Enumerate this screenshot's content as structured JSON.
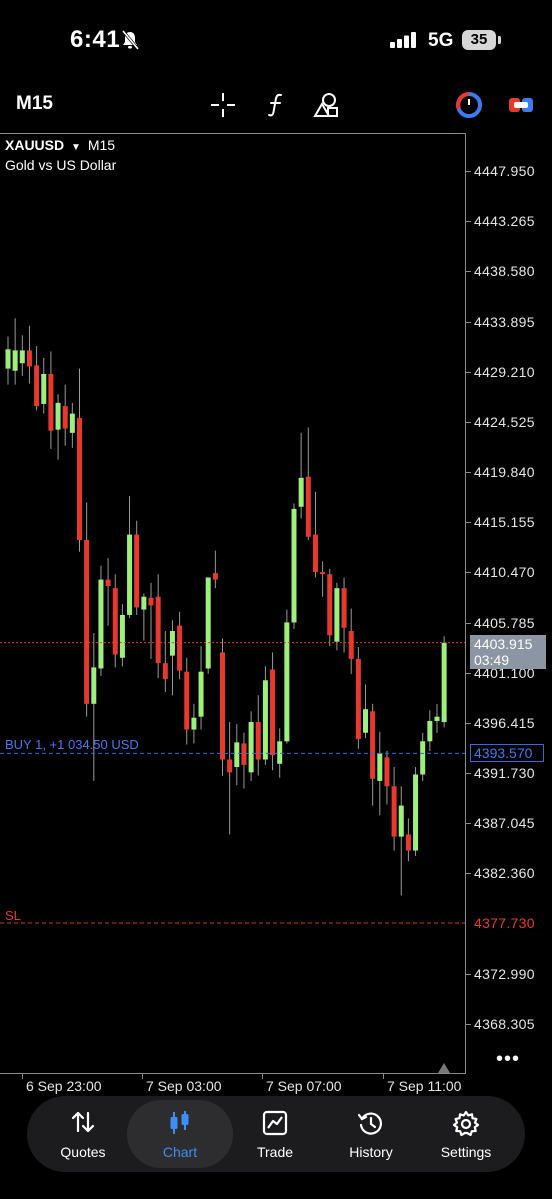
{
  "status_bar": {
    "time": "6:41",
    "network": "5G",
    "battery": "35"
  },
  "toolbar": {
    "timeframe": "M15",
    "icons": [
      "crosshair-icon",
      "indicator-icon",
      "objects-icon",
      "clock-icon",
      "trade-toggle-icon"
    ]
  },
  "chart": {
    "symbol": "XAUUSD",
    "timeframe": "M15",
    "description": "Gold vs US Dollar",
    "colors": {
      "bull": "#9ef07c",
      "bear": "#e8392f",
      "bid_line": "#e0402d",
      "buy_line": "#3c67d8",
      "sl_line": "#d8342d",
      "axis": "#8a8a8a"
    },
    "price_axis": [
      "4447.950",
      "4443.265",
      "4438.580",
      "4433.895",
      "4429.210",
      "4424.525",
      "4419.840",
      "4415.155",
      "4410.470",
      "4405.785",
      "4401.100",
      "4396.415",
      "4391.730",
      "4387.045",
      "4382.360",
      "4377.730",
      "4372.990",
      "4368.305"
    ],
    "bid_price": "4403.915",
    "bar_countdown": "03:49",
    "buy_label": "BUY 1, +1 034.50 USD",
    "buy_price": "4393.570",
    "sl_label": "SL",
    "sl_price": "4377.730",
    "time_axis": [
      "6 Sep 23:00",
      "7 Sep 03:00",
      "7 Sep 07:00",
      "7 Sep 11:00"
    ]
  },
  "chart_data": {
    "type": "candlestick",
    "symbol": "XAUUSD",
    "timeframe": "M15",
    "ylim": [
      4365.5,
      4451.3
    ],
    "candles": [
      {
        "o": 4429.5,
        "h": 4432.5,
        "l": 4428.0,
        "c": 4431.3
      },
      {
        "o": 4429.3,
        "h": 4434.2,
        "l": 4428.0,
        "c": 4431.2
      },
      {
        "o": 4430.0,
        "h": 4432.6,
        "l": 4428.8,
        "c": 4431.2
      },
      {
        "o": 4431.2,
        "h": 4433.5,
        "l": 4428.1,
        "c": 4429.7
      },
      {
        "o": 4429.8,
        "h": 4431.6,
        "l": 4425.6,
        "c": 4426.0
      },
      {
        "o": 4426.2,
        "h": 4430.5,
        "l": 4425.3,
        "c": 4429.0
      },
      {
        "o": 4429.0,
        "h": 4431.1,
        "l": 4422.0,
        "c": 4423.7
      },
      {
        "o": 4423.8,
        "h": 4427.1,
        "l": 4421.0,
        "c": 4426.3
      },
      {
        "o": 4426.0,
        "h": 4428.0,
        "l": 4422.3,
        "c": 4423.9
      },
      {
        "o": 4423.5,
        "h": 4426.3,
        "l": 4422.1,
        "c": 4425.3
      },
      {
        "o": 4424.9,
        "h": 4429.5,
        "l": 4412.4,
        "c": 4413.5
      },
      {
        "o": 4413.5,
        "h": 4417.0,
        "l": 4397.0,
        "c": 4398.2
      },
      {
        "o": 4398.2,
        "h": 4404.8,
        "l": 4391.0,
        "c": 4401.6
      },
      {
        "o": 4401.5,
        "h": 4411.1,
        "l": 4400.8,
        "c": 4409.8
      },
      {
        "o": 4409.8,
        "h": 4411.8,
        "l": 4405.5,
        "c": 4409.2
      },
      {
        "o": 4409.0,
        "h": 4410.3,
        "l": 4401.6,
        "c": 4402.8
      },
      {
        "o": 4402.5,
        "h": 4407.5,
        "l": 4401.7,
        "c": 4406.5
      },
      {
        "o": 4406.5,
        "h": 4417.6,
        "l": 4406.2,
        "c": 4414.0
      },
      {
        "o": 4414.0,
        "h": 4415.3,
        "l": 4406.5,
        "c": 4407.2
      },
      {
        "o": 4407.0,
        "h": 4408.5,
        "l": 4404.1,
        "c": 4408.2
      },
      {
        "o": 4408.1,
        "h": 4409.5,
        "l": 4402.4,
        "c": 4407.4
      },
      {
        "o": 4408.2,
        "h": 4410.3,
        "l": 4400.6,
        "c": 4402.0
      },
      {
        "o": 4402.0,
        "h": 4405.0,
        "l": 4399.3,
        "c": 4400.5
      },
      {
        "o": 4402.7,
        "h": 4406.0,
        "l": 4399.0,
        "c": 4405.0
      },
      {
        "o": 4405.5,
        "h": 4406.8,
        "l": 4400.5,
        "c": 4401.3
      },
      {
        "o": 4401.2,
        "h": 4402.5,
        "l": 4394.4,
        "c": 4395.8
      },
      {
        "o": 4395.8,
        "h": 4398.2,
        "l": 4394.5,
        "c": 4396.9
      },
      {
        "o": 4397.0,
        "h": 4403.6,
        "l": 4395.8,
        "c": 4401.2
      },
      {
        "o": 4401.5,
        "h": 4407.4,
        "l": 4401.0,
        "c": 4410.0
      },
      {
        "o": 4410.4,
        "h": 4412.5,
        "l": 4409.0,
        "c": 4409.8
      },
      {
        "o": 4403.0,
        "h": 4404.3,
        "l": 4391.5,
        "c": 4393.0
      },
      {
        "o": 4393.0,
        "h": 4396.5,
        "l": 4386.0,
        "c": 4391.8
      },
      {
        "o": 4392.3,
        "h": 4396.3,
        "l": 4390.6,
        "c": 4394.6
      },
      {
        "o": 4394.5,
        "h": 4395.5,
        "l": 4390.3,
        "c": 4392.5
      },
      {
        "o": 4391.8,
        "h": 4397.5,
        "l": 4391.0,
        "c": 4396.5
      },
      {
        "o": 4396.5,
        "h": 4399.0,
        "l": 4391.5,
        "c": 4393.0
      },
      {
        "o": 4393.0,
        "h": 4401.7,
        "l": 4392.5,
        "c": 4400.4
      },
      {
        "o": 4401.4,
        "h": 4403.0,
        "l": 4392.0,
        "c": 4393.4
      },
      {
        "o": 4392.6,
        "h": 4395.9,
        "l": 4391.3,
        "c": 4394.7
      },
      {
        "o": 4394.7,
        "h": 4407.0,
        "l": 4394.5,
        "c": 4405.8
      },
      {
        "o": 4405.8,
        "h": 4416.9,
        "l": 4405.2,
        "c": 4416.4
      },
      {
        "o": 4416.6,
        "h": 4423.5,
        "l": 4415.5,
        "c": 4419.3
      },
      {
        "o": 4419.4,
        "h": 4424.0,
        "l": 4413.5,
        "c": 4413.8
      },
      {
        "o": 4414.0,
        "h": 4418.0,
        "l": 4410.0,
        "c": 4410.5
      },
      {
        "o": 4410.5,
        "h": 4411.5,
        "l": 4408.2,
        "c": 4410.3
      },
      {
        "o": 4410.3,
        "h": 4410.8,
        "l": 4403.6,
        "c": 4404.6
      },
      {
        "o": 4404.0,
        "h": 4409.5,
        "l": 4403.2,
        "c": 4409.0
      },
      {
        "o": 4409.0,
        "h": 4410.0,
        "l": 4403.0,
        "c": 4405.3
      },
      {
        "o": 4405.0,
        "h": 4407.1,
        "l": 4401.0,
        "c": 4402.4
      },
      {
        "o": 4402.4,
        "h": 4403.5,
        "l": 4394.0,
        "c": 4394.9
      },
      {
        "o": 4395.5,
        "h": 4400.0,
        "l": 4395.0,
        "c": 4397.7
      },
      {
        "o": 4397.5,
        "h": 4398.2,
        "l": 4388.7,
        "c": 4391.2
      },
      {
        "o": 4391.0,
        "h": 4395.6,
        "l": 4387.8,
        "c": 4393.6
      },
      {
        "o": 4393.2,
        "h": 4393.8,
        "l": 4388.8,
        "c": 4390.5
      },
      {
        "o": 4390.5,
        "h": 4392.3,
        "l": 4384.5,
        "c": 4385.8
      },
      {
        "o": 4385.8,
        "h": 4390.5,
        "l": 4380.3,
        "c": 4388.7
      },
      {
        "o": 4386.0,
        "h": 4387.5,
        "l": 4383.5,
        "c": 4384.5
      },
      {
        "o": 4384.5,
        "h": 4392.3,
        "l": 4384.0,
        "c": 4391.6
      },
      {
        "o": 4391.6,
        "h": 4395.5,
        "l": 4391.0,
        "c": 4394.7
      },
      {
        "o": 4394.7,
        "h": 4397.6,
        "l": 4393.8,
        "c": 4396.6
      },
      {
        "o": 4396.6,
        "h": 4398.2,
        "l": 4395.5,
        "c": 4397.0
      },
      {
        "o": 4396.5,
        "h": 4404.5,
        "l": 4396.0,
        "c": 4403.9
      }
    ]
  },
  "tabs": [
    {
      "label": "Quotes",
      "icon": "quotes-icon"
    },
    {
      "label": "Chart",
      "icon": "chart-icon",
      "active": true
    },
    {
      "label": "Trade",
      "icon": "trade-icon"
    },
    {
      "label": "History",
      "icon": "history-icon"
    },
    {
      "label": "Settings",
      "icon": "settings-icon"
    }
  ]
}
